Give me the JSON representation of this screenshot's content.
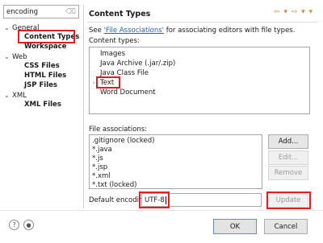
{
  "filter": {
    "value": "encoding"
  },
  "tree": {
    "general": "General",
    "content_types": "Content Types",
    "workspace": "Workspace",
    "web": "Web",
    "css_files": "CSS Files",
    "html_files": "HTML Files",
    "jsp_files": "JSP Files",
    "xml": "XML",
    "xml_files": "XML Files",
    "expanded_glyph": "⌄",
    "collapsed_glyph": "›"
  },
  "page": {
    "title": "Content Types",
    "nav_glyphs": "⇦ ▾ ⇨ ▾ ▾",
    "desc_prefix": "See ",
    "desc_link": "'File Associations'",
    "desc_suffix": " for associating editors with file types.",
    "content_types_label": "Content types:"
  },
  "content_types": [
    "Images",
    "Java Archive (.jar/.zip)",
    "Java Class File",
    "Text",
    "Word Document"
  ],
  "file_associations": {
    "label": "File associations:",
    "items": [
      ".gitignore (locked)",
      "*.java",
      "*.js",
      "*.jsp",
      "*.xml",
      "*.txt (locked)"
    ],
    "add": "Add...",
    "edit": "Edit...",
    "remove": "Remove"
  },
  "encoding": {
    "label": "Default encoding:",
    "value": "UTF-8",
    "update": "Update"
  },
  "footer": {
    "help_glyph": "?",
    "record_glyph": "●",
    "ok": "OK",
    "cancel": "Cancel"
  },
  "colors": {
    "highlight": "#e02020",
    "link": "#2c62b8"
  }
}
